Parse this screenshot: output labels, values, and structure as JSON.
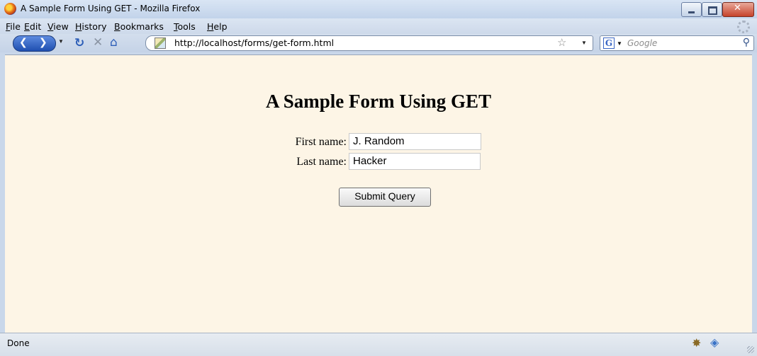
{
  "window": {
    "title": "A Sample Form Using GET - Mozilla Firefox"
  },
  "menu": [
    "File",
    "Edit",
    "View",
    "History",
    "Bookmarks",
    "Tools",
    "Help"
  ],
  "navbar": {
    "url": "http://localhost/forms/get-form.html",
    "search_placeholder": "Google",
    "search_engine_icon": "G"
  },
  "page": {
    "heading": "A Sample Form Using GET",
    "fields": [
      {
        "label": "First name:",
        "value": "J. Random"
      },
      {
        "label": "Last name:",
        "value": "Hacker"
      }
    ],
    "submit_label": "Submit Query"
  },
  "status": {
    "text": "Done"
  },
  "colors": {
    "page_background": "#fdf5e6",
    "chrome_blue": "#c9d7ea"
  }
}
